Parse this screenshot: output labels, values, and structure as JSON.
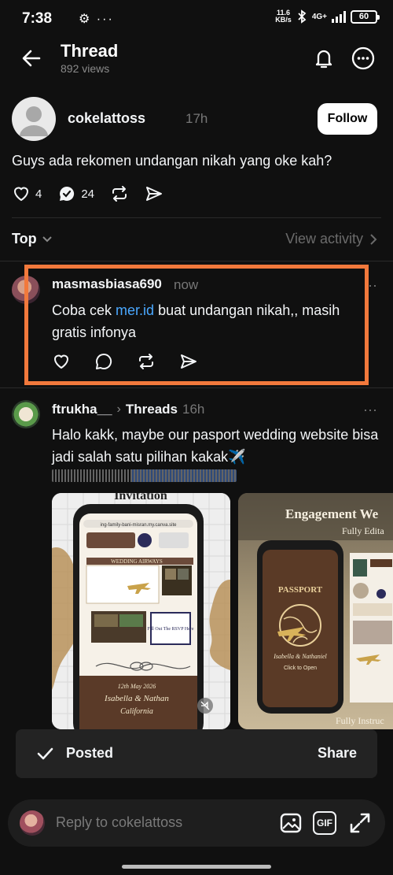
{
  "status_bar": {
    "time": "7:38",
    "left_icons": "⚙ ···",
    "net_speed_value": "11.6",
    "net_speed_unit": "KB/s",
    "network": "4G+",
    "battery": "60"
  },
  "header": {
    "title": "Thread",
    "views": "892 views"
  },
  "original_post": {
    "username": "cokelattoss",
    "time": "17h",
    "follow_label": "Follow",
    "text": "Guys ada rekomen undangan nikah yang oke kah?",
    "likes": "4",
    "replies": "24"
  },
  "sort": {
    "label": "Top",
    "view_activity": "View activity"
  },
  "reply_1": {
    "username": "masmasbiasa690",
    "time": "now",
    "text_before": "Coba cek ",
    "link": "mer.id",
    "text_after": " buat undangan nikah,, masih gratis infonya",
    "highlight_color": "#f2793c"
  },
  "reply_2": {
    "username": "ftrukha__",
    "chevron": "›",
    "context": "Threads",
    "time": "16h",
    "text": "Halo kakk, maybe our pasport wedding website bisa jadi salah satu pilihan kakak✈️",
    "image_1": {
      "heading": "Invitation",
      "url_bar": "ing-family-bani-misran.my.canva.site",
      "banner": "WEDDING AIRWAYS",
      "rsvp": "Fill Out The RSVP Here",
      "date": "12th May 2026",
      "couple": "Isabella & Nathan",
      "place": "California"
    },
    "image_2": {
      "heading": "Engagement We",
      "subheading": "Fully Edita",
      "passport_title": "PASSPORT",
      "couple": "Isabella & Nathaniel",
      "cta": "Click to Open",
      "footer": "Fully Instruc"
    }
  },
  "toast": {
    "label": "Posted",
    "action": "Share"
  },
  "reply_bar": {
    "placeholder": "Reply to cokelattoss",
    "gif_label": "GIF"
  }
}
